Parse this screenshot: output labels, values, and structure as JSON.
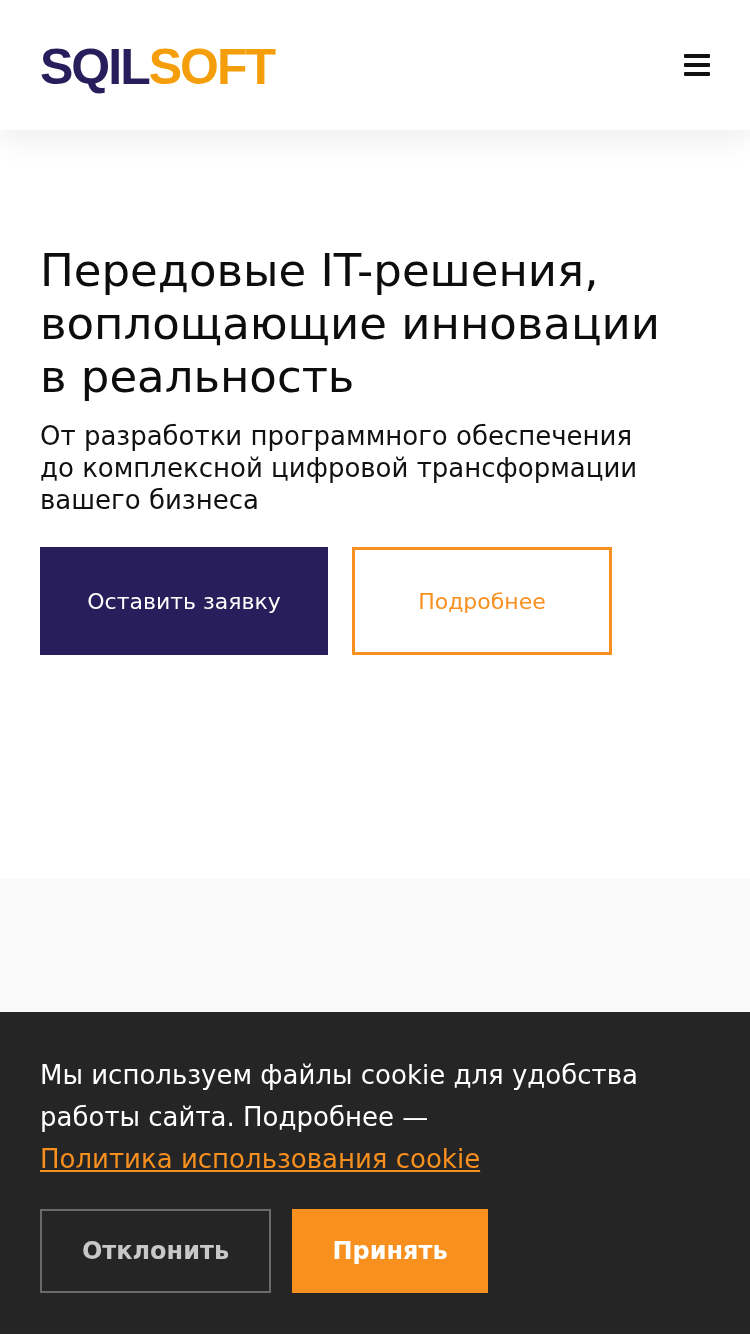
{
  "header": {
    "logo": [
      {
        "text": "SQIL",
        "color": "#271e5b"
      },
      {
        "text": "SOFT",
        "color": "#f59e0b"
      }
    ]
  },
  "hero": {
    "title": "Передовые IT-решения, воплощающие инновации в реальность",
    "subtitle": "От разработки программного обеспечения до комплексной цифровой трансформации вашего бизнеса",
    "buttons": [
      {
        "label": "Оставить заявку",
        "kind": "primary"
      },
      {
        "label": "Подробнее",
        "kind": "outline"
      }
    ]
  },
  "cookie_banner": {
    "text": "Мы используем файлы cookie для удобства работы сайта. Подробнее —",
    "link": "Политика использования cookie",
    "buttons": [
      {
        "label": "Отклонить",
        "kind": "decline"
      },
      {
        "label": "Принять",
        "kind": "accept"
      }
    ]
  }
}
